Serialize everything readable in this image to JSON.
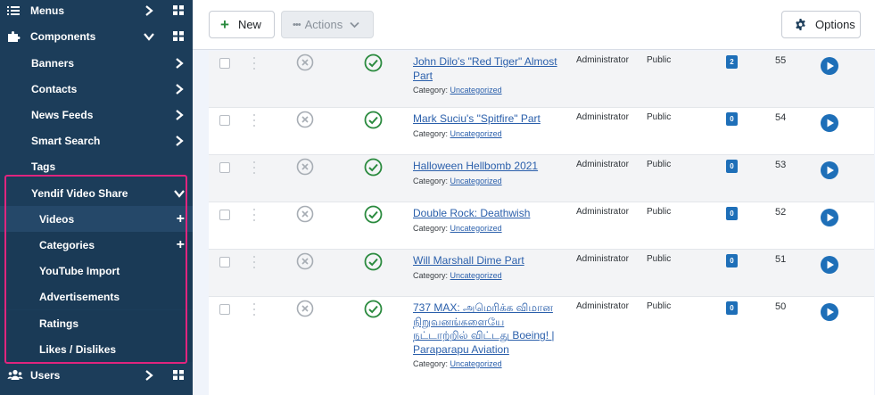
{
  "sidebar": {
    "menus_label": "Menus",
    "components_label": "Components",
    "banners_label": "Banners",
    "contacts_label": "Contacts",
    "newsfeeds_label": "News Feeds",
    "smartsearch_label": "Smart Search",
    "tags_label": "Tags",
    "yendif_label": "Yendif Video Share",
    "videos_label": "Videos",
    "categories_label": "Categories",
    "youtube_label": "YouTube Import",
    "ads_label": "Advertisements",
    "ratings_label": "Ratings",
    "likes_label": "Likes / Dislikes",
    "users_label": "Users"
  },
  "toolbar": {
    "new_label": "New",
    "actions_label": "Actions",
    "options_label": "Options"
  },
  "colors": {
    "sidebar_bg": "#1c3d5a",
    "highlight": "#e0257e",
    "published": "#2a8a3e",
    "link": "#2a5fab",
    "badge": "#1e6fb8"
  },
  "rows": [
    {
      "title": "John Dilo's \"Red Tiger\" Almost Part",
      "category_prefix": "Category:",
      "category": "Uncategorized",
      "access": "Administrator",
      "language": "Public",
      "count": "2",
      "id": "55"
    },
    {
      "title": "Mark Suciu's \"Spitfire\" Part",
      "category_prefix": "Category:",
      "category": "Uncategorized",
      "access": "Administrator",
      "language": "Public",
      "count": "0",
      "id": "54"
    },
    {
      "title": "Halloween Hellbomb 2021",
      "category_prefix": "Category:",
      "category": "Uncategorized",
      "access": "Administrator",
      "language": "Public",
      "count": "0",
      "id": "53"
    },
    {
      "title": "Double Rock: Deathwish",
      "category_prefix": "Category:",
      "category": "Uncategorized",
      "access": "Administrator",
      "language": "Public",
      "count": "0",
      "id": "52"
    },
    {
      "title": "Will Marshall Dime Part",
      "category_prefix": "Category:",
      "category": "Uncategorized",
      "access": "Administrator",
      "language": "Public",
      "count": "0",
      "id": "51"
    },
    {
      "title": "737 MAX: அமெரிக்க விமான நிறுவனங்களையே நட்டாற்றில் விட்டது Boeing! | Paraparapu Aviation",
      "category_prefix": "Category:",
      "category": "Uncategorized",
      "access": "Administrator",
      "language": "Public",
      "count": "0",
      "id": "50"
    }
  ]
}
